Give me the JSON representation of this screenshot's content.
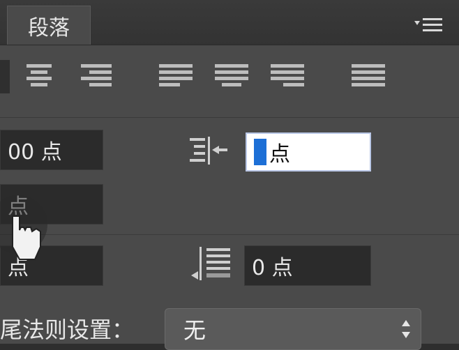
{
  "panel": {
    "tab_label": "段落"
  },
  "fields": {
    "left_indent_value": "00 点",
    "first_line_indent_value": "点",
    "space_before_value": "点",
    "right_indent_value": "点",
    "space_after_value": "0 点"
  },
  "hyphenation": {
    "label": "尾法则设置：",
    "selected": "无"
  },
  "icons": {
    "panel_menu": "panel-menu-icon",
    "right_indent": "right-indent-icon",
    "space_after": "space-after-icon"
  },
  "colors": {
    "panel_bg": "#4a4a4a",
    "field_bg": "#2b2b2b",
    "active_field_bg": "#ffffff",
    "caret": "#1d6fd6"
  }
}
